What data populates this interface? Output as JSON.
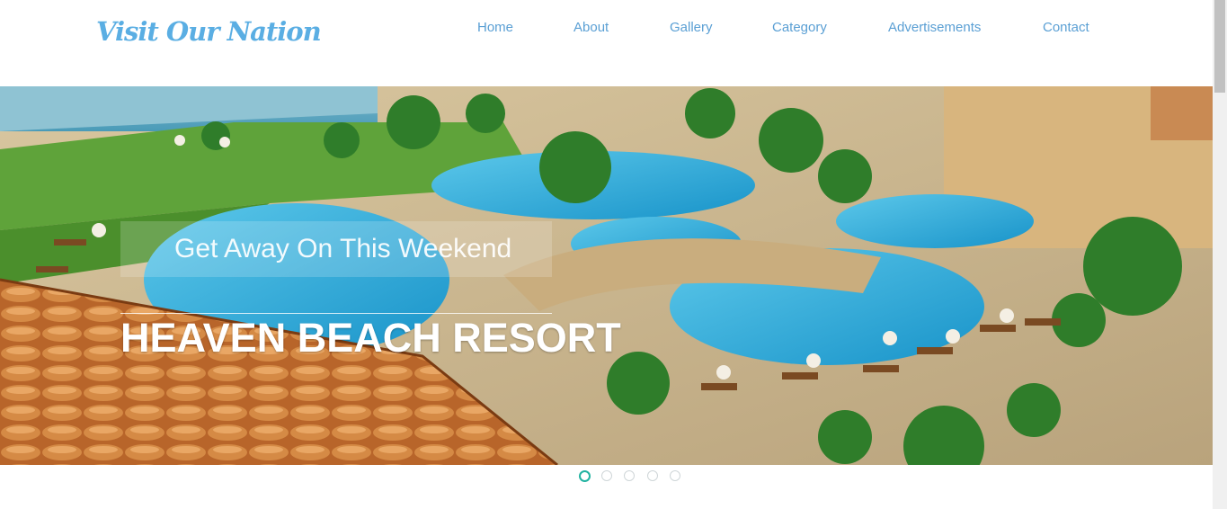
{
  "site": {
    "logo": "Visit Our Nation"
  },
  "nav": {
    "items": [
      "Home",
      "About",
      "Gallery",
      "Category",
      "Advertisements",
      "Contact"
    ]
  },
  "hero": {
    "subtitle": "Get Away On This Weekend",
    "title": "HEAVEN BEACH RESORT",
    "slide_count": 5,
    "active_slide": 1
  },
  "colors": {
    "logo": "#5aaee3",
    "nav_link": "#5a9fd4",
    "dot_active": "#22b3a1",
    "pool": "#1fa7d8"
  }
}
